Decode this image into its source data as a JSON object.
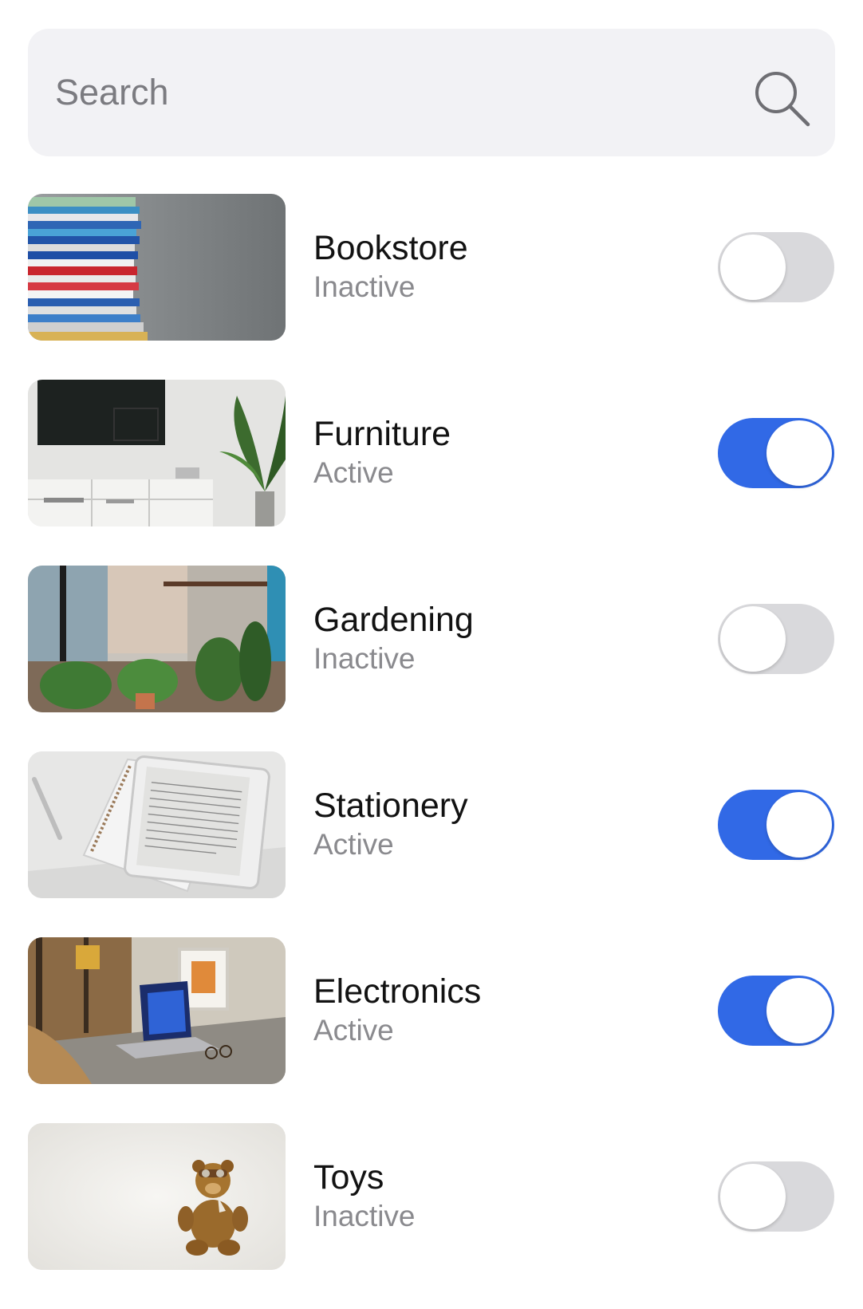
{
  "search": {
    "placeholder": "Search",
    "icon": "search-icon"
  },
  "categories": [
    {
      "name": "Bookstore",
      "status": "Inactive",
      "active": false,
      "image": "stacked-books-photo"
    },
    {
      "name": "Furniture",
      "status": "Active",
      "active": true,
      "image": "living-room-tv-photo"
    },
    {
      "name": "Gardening",
      "status": "Inactive",
      "active": false,
      "image": "potted-plants-photo"
    },
    {
      "name": "Stationery",
      "status": "Active",
      "active": true,
      "image": "ereader-notebook-photo"
    },
    {
      "name": "Electronics",
      "status": "Active",
      "active": true,
      "image": "laptop-desk-photo"
    },
    {
      "name": "Toys",
      "status": "Inactive",
      "active": false,
      "image": "teddy-bear-photo"
    }
  ],
  "colors": {
    "toggle_on": "#3169e6",
    "toggle_off": "#d9d9dc",
    "search_bg": "#f2f2f5"
  }
}
